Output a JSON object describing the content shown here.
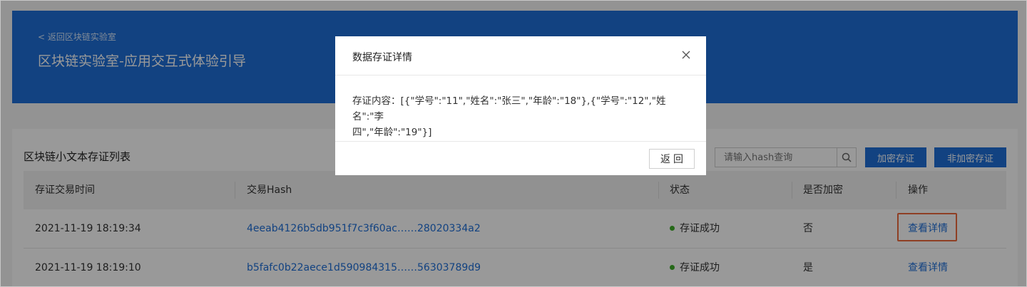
{
  "header": {
    "back_label": "< 返回区块链实验室",
    "title": "区块链实验室-应用交互式体验引导"
  },
  "list": {
    "title": "区块链小文本存证列表",
    "search_placeholder": "请输入hash查询",
    "encrypt_button": "加密存证",
    "nonencrypt_button": "非加密存证",
    "columns": [
      "存证交易时间",
      "交易Hash",
      "状态",
      "是否加密",
      "操作"
    ],
    "rows": [
      {
        "time": "2021-11-19 18:19:34",
        "hash": "4eeab4126b5db951f7c3f60ac……28020334a2",
        "status": "存证成功",
        "encrypted": "否",
        "action": "查看详情"
      },
      {
        "time": "2021-11-19 18:19:10",
        "hash": "b5fafc0b22aece1d590984315……56303789d9",
        "status": "存证成功",
        "encrypted": "是",
        "action": "查看详情"
      }
    ]
  },
  "modal": {
    "title": "数据存证详情",
    "content_line1": "存证内容：[{\"学号\":\"11\",\"姓名\":\"张三\",\"年龄\":\"18\"},{\"学号\":\"12\",\"姓名\":\"李",
    "content_line2": "四\",\"年龄\":\"19\"}]",
    "return_button": "返回"
  },
  "colors": {
    "brand_blue": "#1f6fd8",
    "status_green": "#3fae29",
    "highlight_orange": "#ef6a3d"
  },
  "icons": [
    "search-icon",
    "close-icon"
  ]
}
